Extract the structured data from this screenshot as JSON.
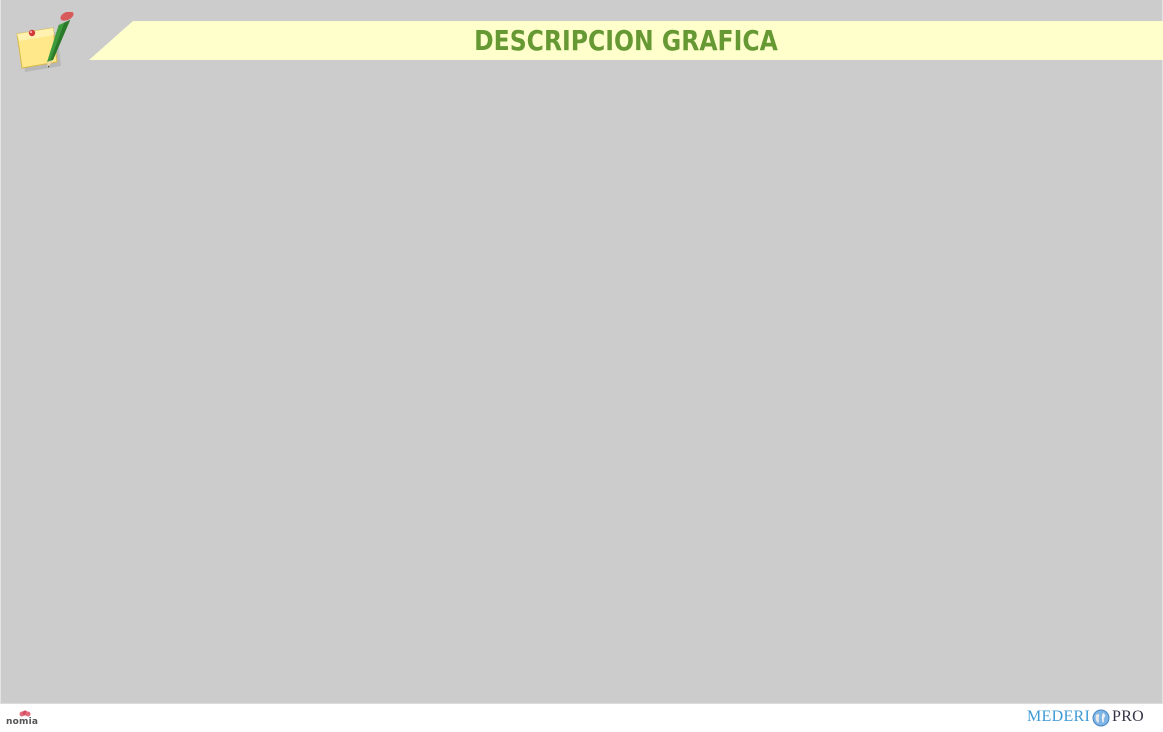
{
  "slide": {
    "title": "DESCRIPCION GRAFICA",
    "background_color": "#cccccc",
    "title_band_color": "#ffffcc",
    "title_color": "#669933",
    "header_icon": "note-and-pencil-icon"
  },
  "footer": {
    "left_logo": {
      "text": "nomia",
      "icon": "nomia-logo-mark"
    },
    "right_logo": {
      "text_left": "MEDERI",
      "icon": "globe-icon",
      "text_right": "PRO",
      "color_left": "#3d9ad6",
      "color_right": "#333344"
    }
  }
}
